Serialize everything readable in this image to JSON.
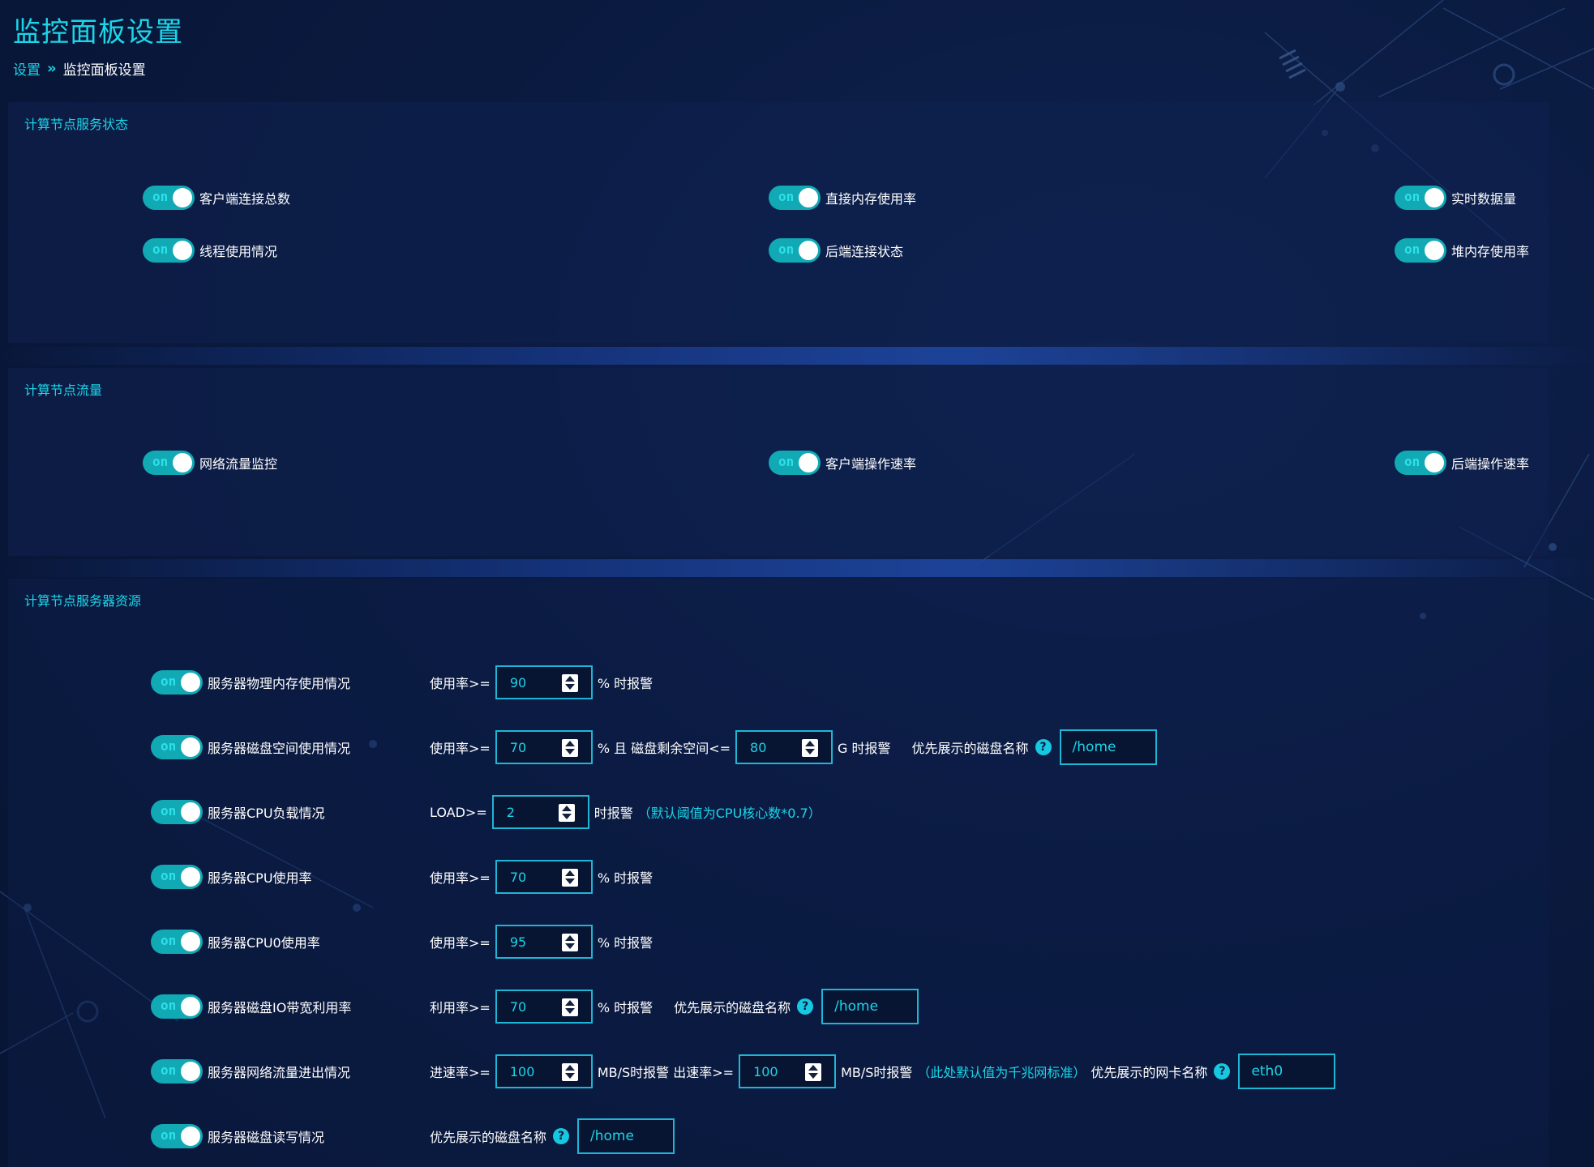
{
  "page": {
    "title": "监控面板设置"
  },
  "breadcrumb": {
    "parent": "设置",
    "separator": "»",
    "current": "监控面板设置"
  },
  "toggle_on_text": "on",
  "colors": {
    "accent": "#1bd6e8",
    "toggle_bg": "#10a9b4",
    "background": "#0a1a3f"
  },
  "sections": [
    {
      "title": "计算节点服务状态",
      "items": [
        {
          "label": "客户端连接总数",
          "on": true
        },
        {
          "label": "直接内存使用率",
          "on": true
        },
        {
          "label": "实时数据量",
          "on": true
        },
        {
          "label": "线程使用情况",
          "on": true
        },
        {
          "label": "后端连接状态",
          "on": true
        },
        {
          "label": "堆内存使用率",
          "on": true
        }
      ]
    },
    {
      "title": "计算节点流量",
      "items": [
        {
          "label": "网络流量监控",
          "on": true
        },
        {
          "label": "客户端操作速率",
          "on": true
        },
        {
          "label": "后端操作速率",
          "on": true
        }
      ]
    },
    {
      "title": "计算节点服务器资源",
      "rows": [
        {
          "label": "服务器物理内存使用情况",
          "on": true,
          "t1": "使用率>=",
          "v1": "90",
          "t2": "% 时报警"
        },
        {
          "label": "服务器磁盘空间使用情况",
          "on": true,
          "t1": "使用率>=",
          "v1": "70",
          "t2": "% 且 磁盘剩余空间<=",
          "v2": "80",
          "t3": "G 时报警",
          "t4": "优先展示的磁盘名称",
          "input": "/home"
        },
        {
          "label": "服务器CPU负载情况",
          "on": true,
          "t1": "LOAD>=",
          "v1": "2",
          "t2": "时报警",
          "hint": "（默认阈值为CPU核心数*0.7）"
        },
        {
          "label": "服务器CPU使用率",
          "on": true,
          "t1": "使用率>=",
          "v1": "70",
          "t2": "% 时报警"
        },
        {
          "label": "服务器CPU0使用率",
          "on": true,
          "t1": "使用率>=",
          "v1": "95",
          "t2": "% 时报警"
        },
        {
          "label": "服务器磁盘IO带宽利用率",
          "on": true,
          "t1": "利用率>=",
          "v1": "70",
          "t2": "% 时报警",
          "t4": "优先展示的磁盘名称",
          "input": "/home"
        },
        {
          "label": "服务器网络流量进出情况",
          "on": true,
          "t1": "进速率>=",
          "v1": "100",
          "t2": "MB/S时报警 出速率>=",
          "v2": "100",
          "t3": "MB/S时报警",
          "hint": "（此处默认值为千兆网标准）",
          "t4": "优先展示的网卡名称",
          "input": "eth0"
        },
        {
          "label": "服务器磁盘读写情况",
          "on": true,
          "t4": "优先展示的磁盘名称",
          "input": "/home"
        }
      ]
    }
  ]
}
